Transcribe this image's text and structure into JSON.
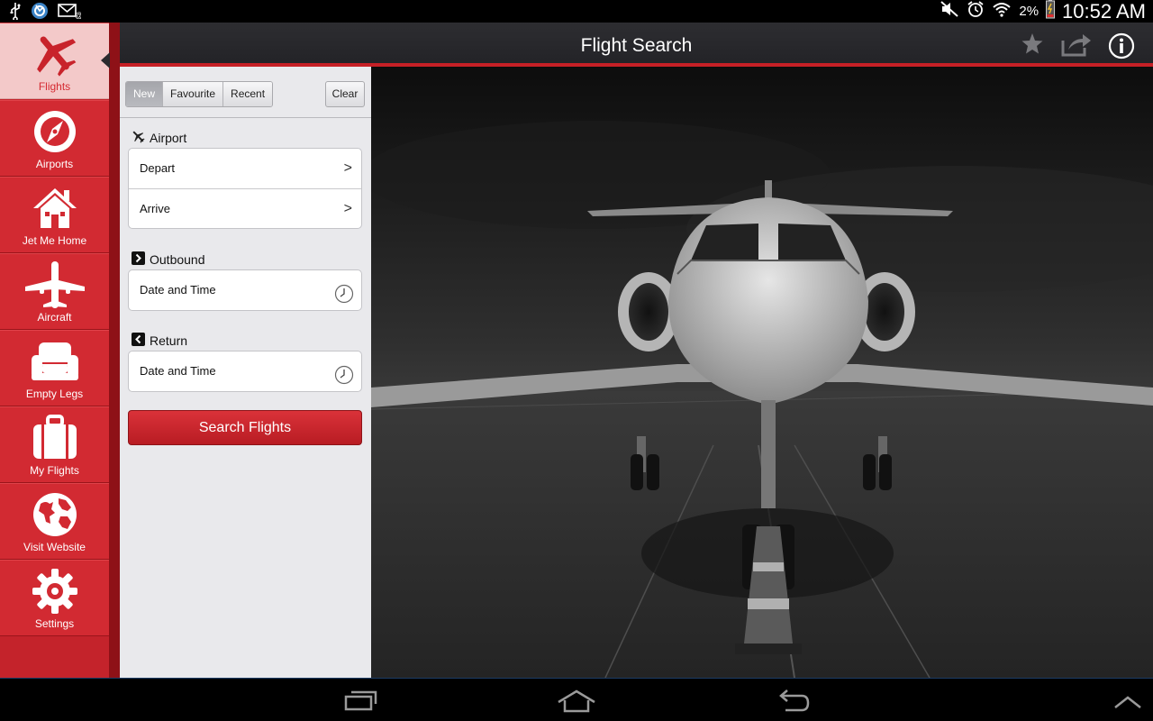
{
  "status_bar": {
    "battery_percent": "2%",
    "time": "10:52 AM",
    "icons": [
      "usb-icon",
      "sync-icon",
      "email-icon",
      "mute-icon",
      "alarm-icon",
      "wifi-icon",
      "battery-low-icon"
    ]
  },
  "sidebar": {
    "items": [
      {
        "label": "Flights",
        "icon": "plane-icon",
        "active": true
      },
      {
        "label": "Airports",
        "icon": "compass-icon"
      },
      {
        "label": "Jet Me Home",
        "icon": "home-icon"
      },
      {
        "label": "Aircraft",
        "icon": "aircraft-icon"
      },
      {
        "label": "Empty Legs",
        "icon": "armchair-icon"
      },
      {
        "label": "My Flights",
        "icon": "luggage-icon"
      },
      {
        "label": "Visit Website",
        "icon": "globe-icon"
      },
      {
        "label": "Settings",
        "icon": "gear-icon"
      }
    ]
  },
  "header": {
    "title": "Flight Search",
    "actions": [
      "star-icon",
      "share-icon",
      "info-icon"
    ]
  },
  "form": {
    "tabs": [
      {
        "label": "New",
        "selected": true
      },
      {
        "label": "Favourite"
      },
      {
        "label": "Recent"
      }
    ],
    "clear_label": "Clear",
    "airport": {
      "title": "Airport",
      "depart_label": "Depart",
      "arrive_label": "Arrive"
    },
    "outbound": {
      "title": "Outbound",
      "placeholder": "Date and Time"
    },
    "return": {
      "title": "Return",
      "placeholder": "Date and Time"
    },
    "search_button": "Search Flights"
  },
  "colors": {
    "accent": "#c4232b",
    "header_bg": "#29292d",
    "panel_bg": "#e9e9ec"
  }
}
